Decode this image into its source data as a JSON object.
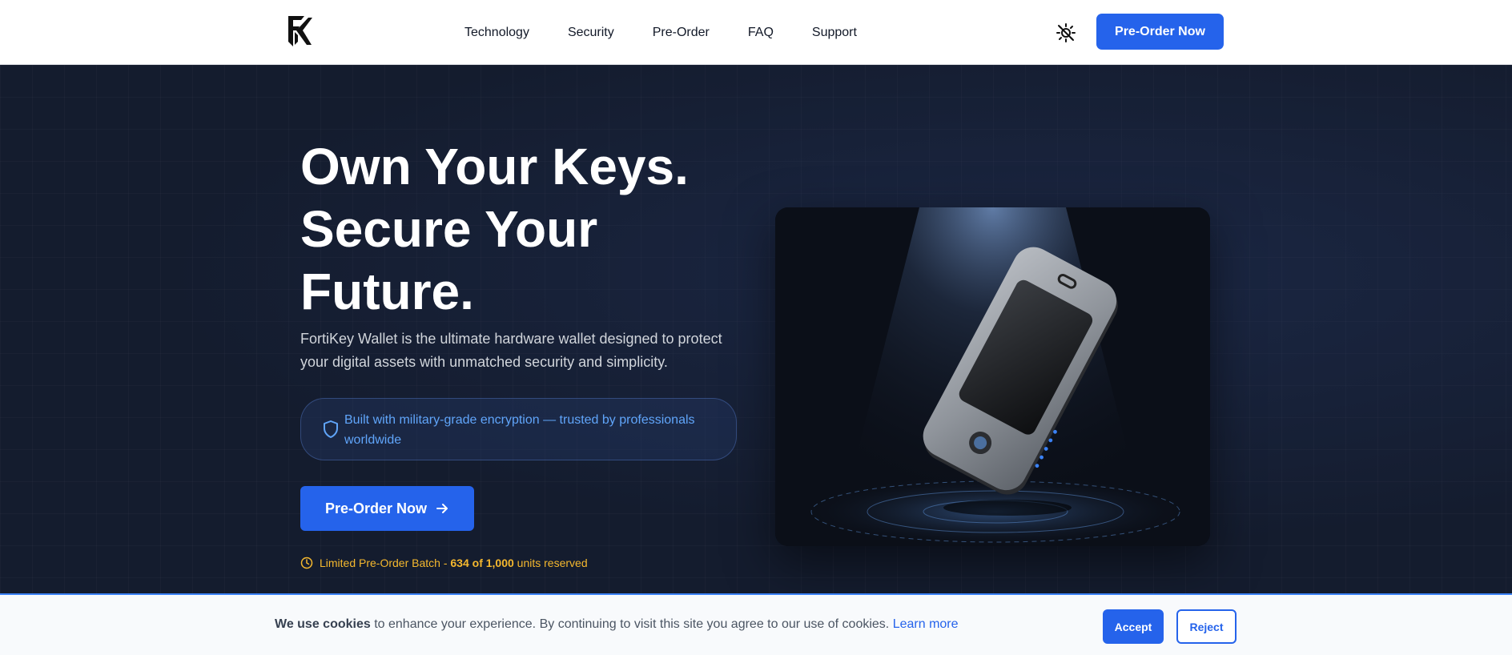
{
  "header": {
    "logo_icon": "fk-logo-icon",
    "nav": [
      "Technology",
      "Security",
      "Pre-Order",
      "FAQ",
      "Support"
    ],
    "theme_toggle_icon": "theme-toggle-icon",
    "cta_label": "Pre-Order Now"
  },
  "hero": {
    "title_lines": [
      "Own Your Keys.",
      "Secure Your",
      "Future."
    ],
    "description": "FortiKey Wallet is the ultimate hardware wallet designed to protect your digital assets with unmatched security and simplicity.",
    "trust_icon": "shield-icon",
    "trust_text": "Built with military-grade encryption — trusted by professionals worldwide",
    "cta_label": "Pre-Order Now",
    "cta_icon": "arrow-right-icon",
    "batch_icon": "clock-icon",
    "batch_prefix": "Limited Pre-Order Batch - ",
    "batch_count": "634 of 1,000",
    "batch_suffix": " units reserved",
    "product_image": "hardware-wallet-product-image"
  },
  "cookie": {
    "bold": "We use cookies",
    "text": " to enhance your experience. By continuing to visit this site you agree to our use of cookies. ",
    "link": "Learn more",
    "accept_label": "Accept",
    "reject_label": "Reject"
  },
  "colors": {
    "primary": "#2563eb",
    "hero_bg": "#141c2e",
    "trust_text": "#60a5fa",
    "batch": "#f5b82e"
  }
}
